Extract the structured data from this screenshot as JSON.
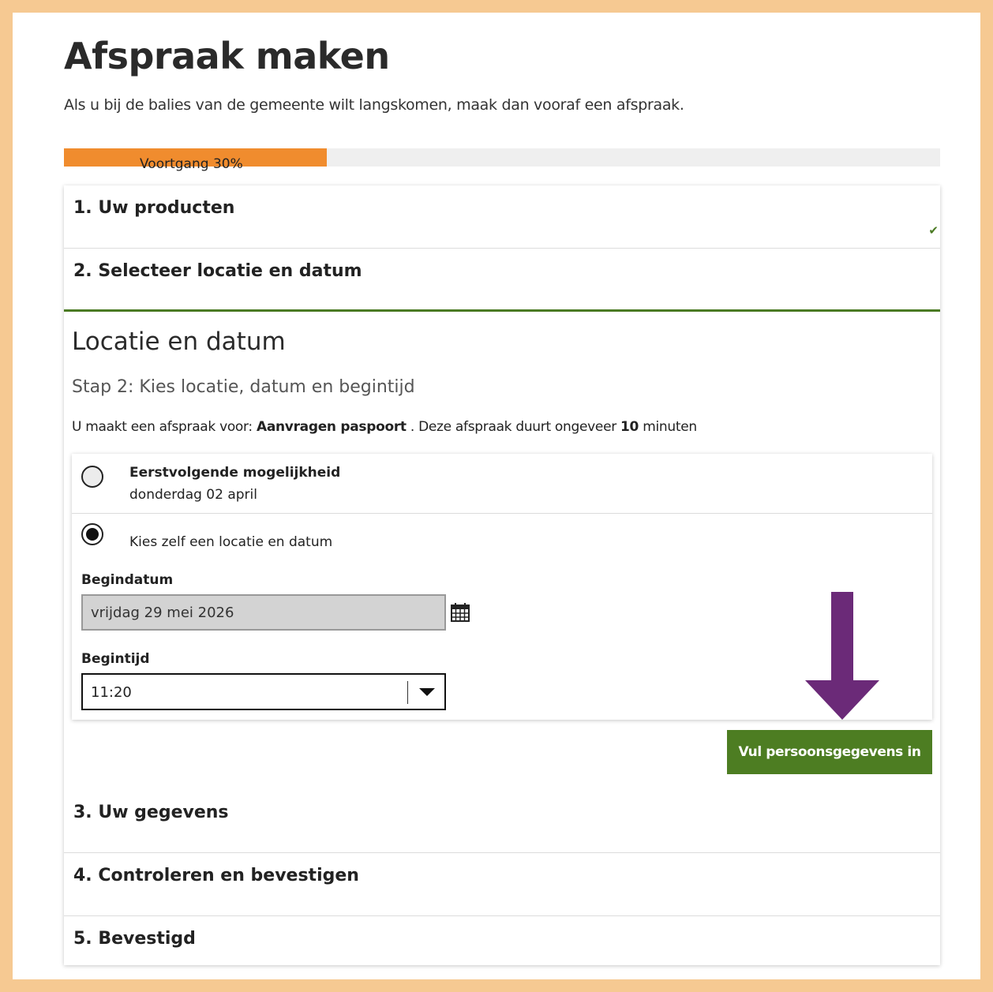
{
  "page": {
    "title": "Afspraak maken",
    "intro": "Als u bij de balies van de gemeente wilt langskomen, maak dan vooraf een afspraak."
  },
  "progress": {
    "label": "Voortgang 30%",
    "percent": 30,
    "fill_color": "#f08c2e"
  },
  "steps": [
    {
      "label": "1. Uw producten",
      "completed": true
    },
    {
      "label": "2. Selecteer locatie en datum",
      "active": true
    },
    {
      "label": "3. Uw gegevens"
    },
    {
      "label": "4. Controleren en bevestigen"
    },
    {
      "label": "5. Bevestigd"
    }
  ],
  "section": {
    "title": "Locatie en datum",
    "subtitle": "Stap 2: Kies locatie, datum en begintijd",
    "info_prefix": "U maakt een afspraak voor: ",
    "product": "Aanvragen paspoort",
    "info_middle": " . Deze afspraak duurt ongeveer ",
    "duration": "10",
    "info_suffix": " minuten"
  },
  "options": {
    "first": {
      "title": "Eerstvolgende mogelijkheid",
      "date": "donderdag 02 april",
      "selected": false
    },
    "custom": {
      "label": "Kies zelf een locatie en datum",
      "selected": true
    }
  },
  "fields": {
    "start_date_label": "Begindatum",
    "start_date_value": "vrijdag 29 mei 2026",
    "start_time_label": "Begintijd",
    "start_time_value": "11:20"
  },
  "actions": {
    "next_label": "Vul persoonsgegevens in"
  },
  "colors": {
    "accent_green": "#4d7d22",
    "frame": "#f6c992",
    "annotation_arrow": "#6b2a78"
  },
  "icons": [
    "check-icon",
    "calendar-icon",
    "chevron-down-icon",
    "arrow-down-icon"
  ]
}
